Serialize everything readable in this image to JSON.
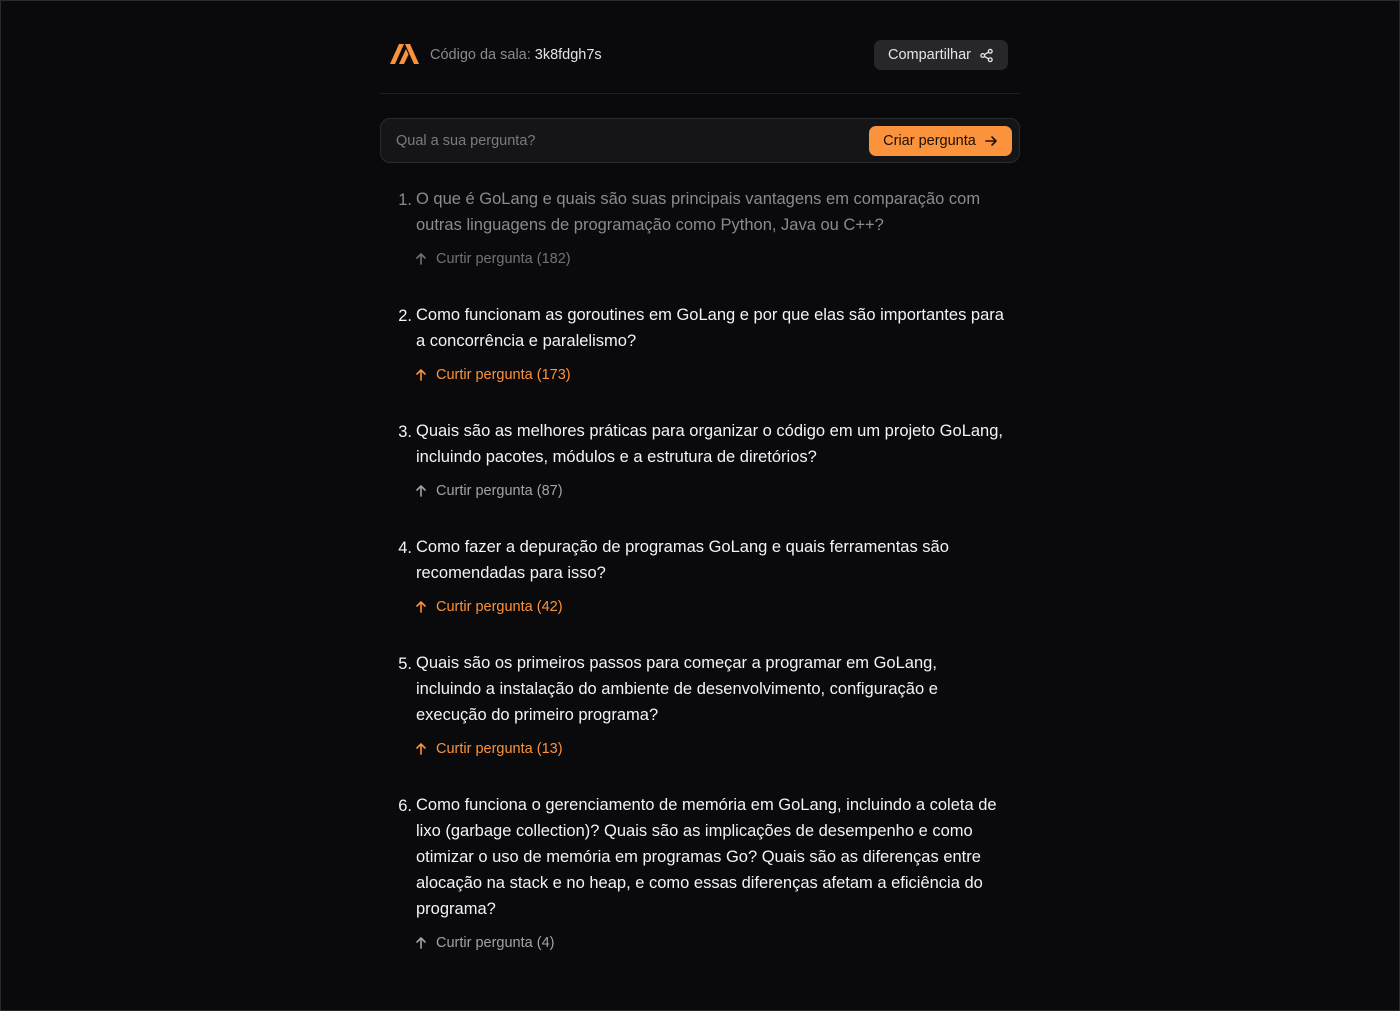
{
  "header": {
    "room_label": "Código da sala:",
    "room_code": "3k8fdgh7s",
    "share_label": "Compartilhar"
  },
  "form": {
    "placeholder": "Qual a sua pergunta?",
    "submit_label": "Criar pergunta"
  },
  "colors": {
    "accent": "#fb923c",
    "background": "#0a0a0c",
    "muted": "#8a8a90"
  },
  "questions": [
    {
      "number": "1.",
      "text": "O que é GoLang e quais são suas principais vantagens em comparação com outras linguagens de programação como Python, Java ou C++?",
      "like_label": "Curtir pergunta (182)",
      "liked": false,
      "answered": true
    },
    {
      "number": "2.",
      "text": "Como funcionam as goroutines em GoLang e por que elas são importantes para a concorrência e paralelismo?",
      "like_label": "Curtir pergunta (173)",
      "liked": true,
      "answered": false
    },
    {
      "number": "3.",
      "text": "Quais são as melhores práticas para organizar o código em um projeto GoLang, incluindo pacotes, módulos e a estrutura de diretórios?",
      "like_label": "Curtir pergunta (87)",
      "liked": false,
      "answered": false
    },
    {
      "number": "4.",
      "text": "Como fazer a depuração de programas GoLang e quais ferramentas são recomendadas para isso?",
      "like_label": "Curtir pergunta (42)",
      "liked": true,
      "answered": false
    },
    {
      "number": "5.",
      "text": "Quais são os primeiros passos para começar a programar em GoLang, incluindo a instalação do ambiente de desenvolvimento, configuração e execução do primeiro programa?",
      "like_label": "Curtir pergunta (13)",
      "liked": true,
      "answered": false
    },
    {
      "number": "6.",
      "text": "Como funciona o gerenciamento de memória em GoLang, incluindo a coleta de lixo (garbage collection)? Quais são as implicações de desempenho e como otimizar o uso de memória em programas Go? Quais são as diferenças entre alocação na stack e no heap, e como essas diferenças afetam a eficiência do programa?",
      "like_label": "Curtir pergunta (4)",
      "liked": false,
      "answered": false
    }
  ]
}
